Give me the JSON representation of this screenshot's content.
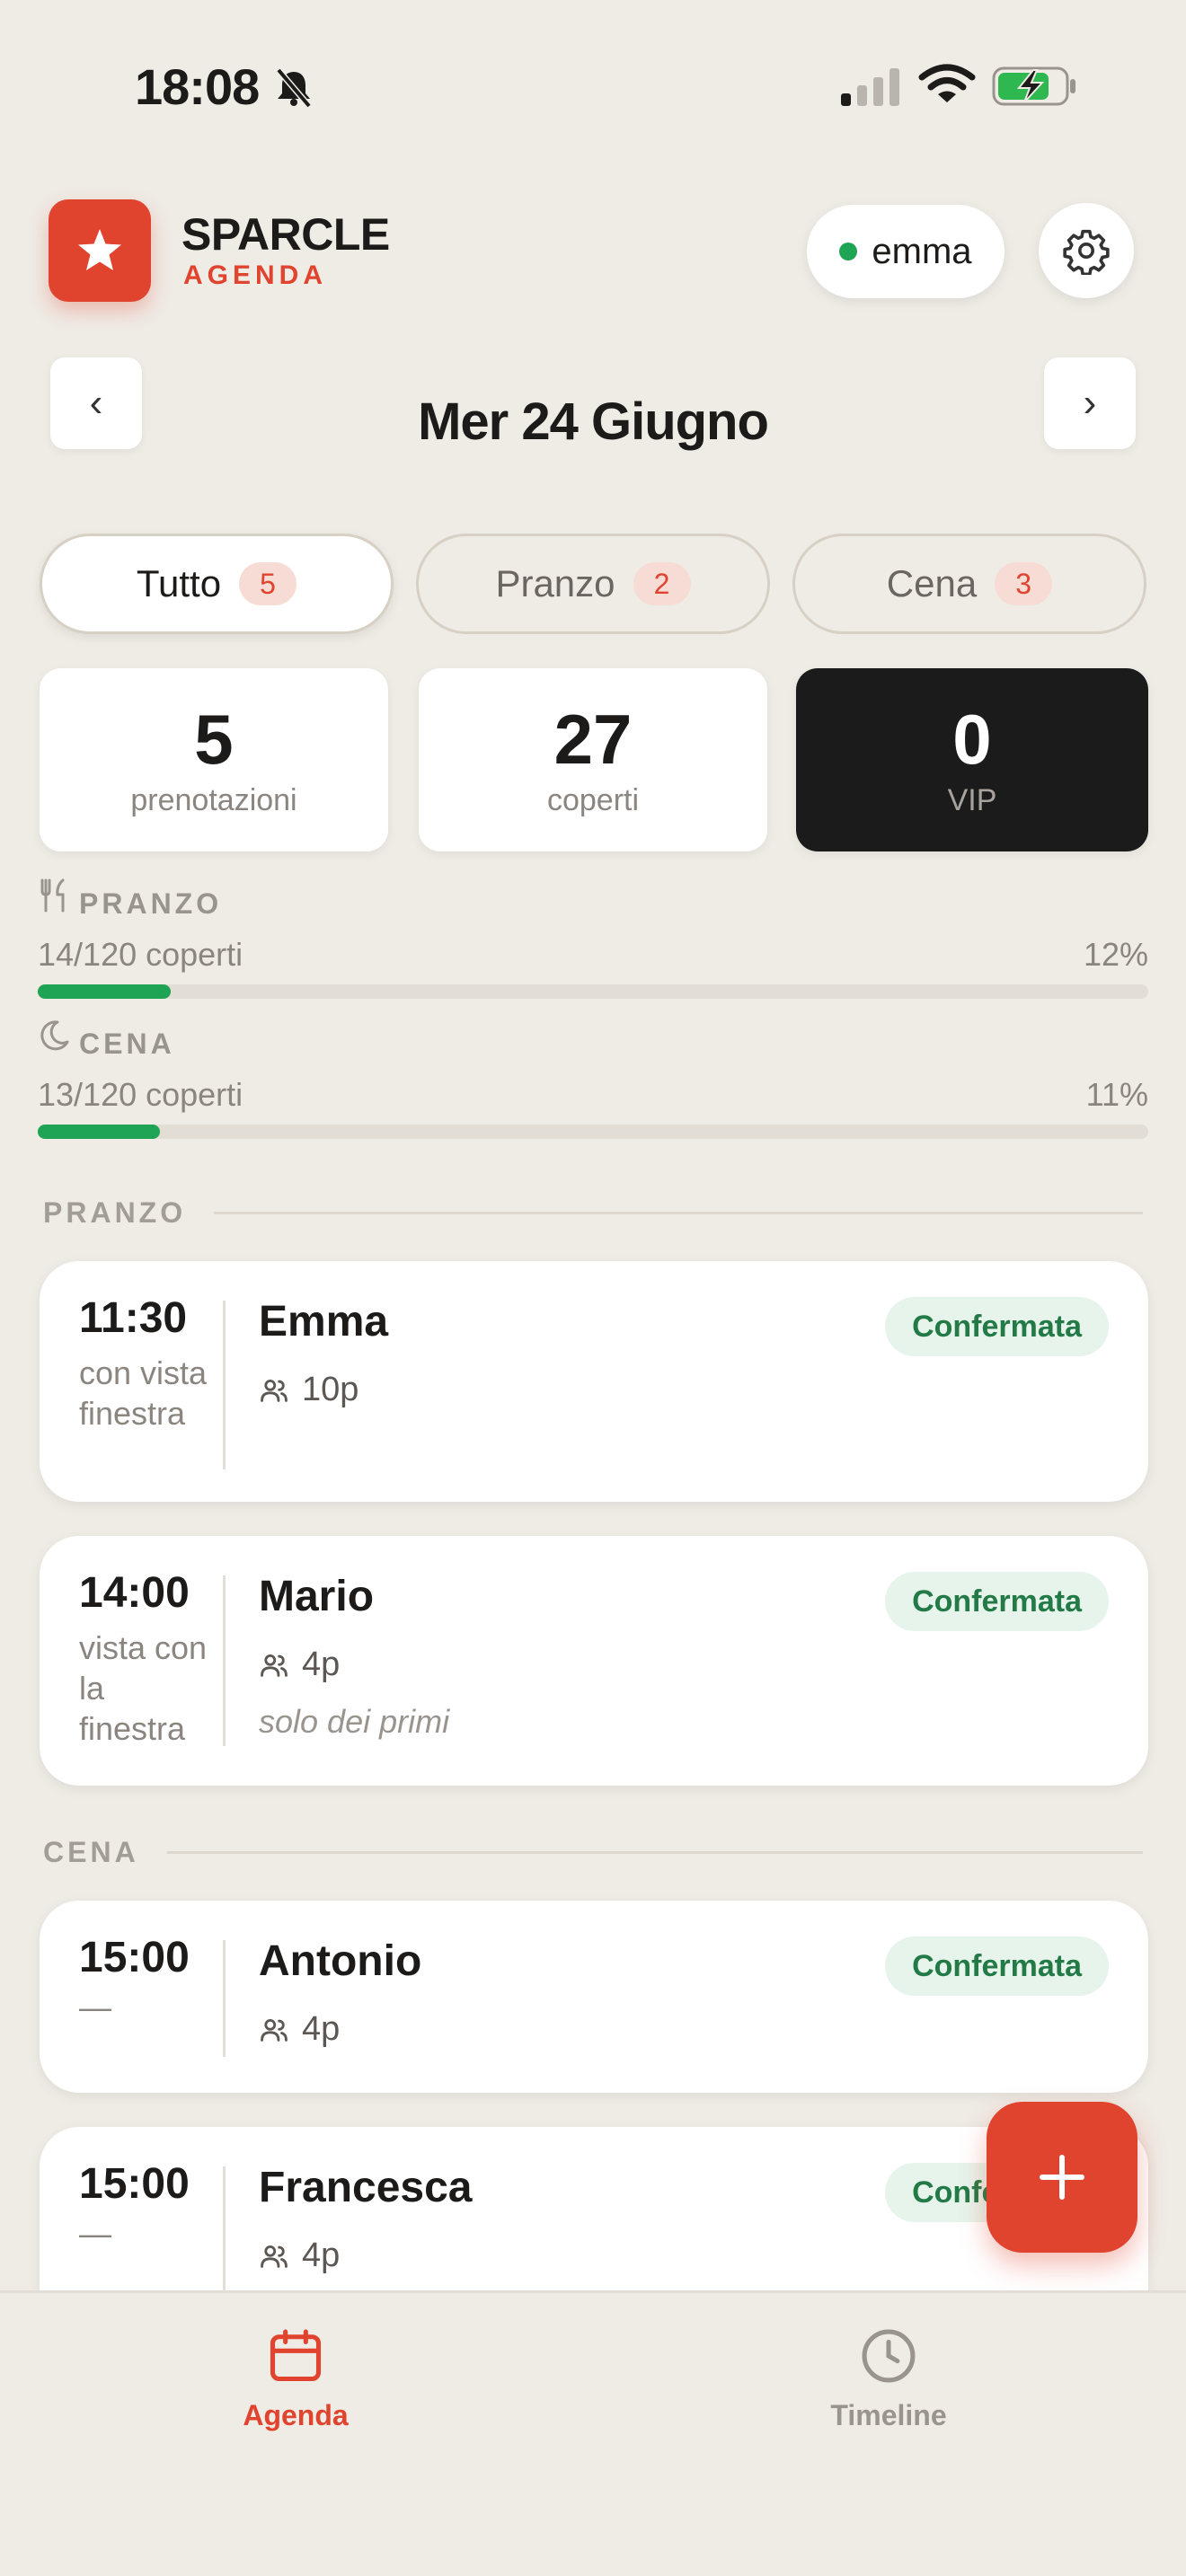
{
  "status_bar": {
    "time": "18:08"
  },
  "header": {
    "brand_name": "SPARCLE",
    "brand_sub": "AGENDA",
    "user": "emma",
    "accent_color": "#e0442f",
    "online_color": "#1fa456"
  },
  "date_nav": {
    "prev": "‹",
    "next": "›",
    "date": "Mer 24 Giugno"
  },
  "filters": [
    {
      "label": "Tutto",
      "count": "5",
      "active": true
    },
    {
      "label": "Pranzo",
      "count": "2",
      "active": false
    },
    {
      "label": "Cena",
      "count": "3",
      "active": false
    }
  ],
  "stats": [
    {
      "value": "5",
      "label": "prenotazioni"
    },
    {
      "value": "27",
      "label": "coperti"
    },
    {
      "value": "0",
      "label": "VIP"
    }
  ],
  "capacity": [
    {
      "title": "PRANZO",
      "text": "14/120 coperti",
      "percent_label": "12%",
      "fill": 0.12,
      "icon": "utensils-icon"
    },
    {
      "title": "CENA",
      "text": "13/120 coperti",
      "percent_label": "11%",
      "fill": 0.11,
      "icon": "moon-icon"
    }
  ],
  "sections": [
    {
      "title": "PRANZO",
      "reservations": [
        {
          "time": "11:30",
          "note": "con vista finestra",
          "name": "Emma",
          "party": "10p",
          "comment": "",
          "status": "Confermata"
        },
        {
          "time": "14:00",
          "note": "vista con la finestra",
          "name": "Mario",
          "party": "4p",
          "comment": "solo dei primi",
          "status": "Confermata"
        }
      ]
    },
    {
      "title": "CENA",
      "reservations": [
        {
          "time": "15:00",
          "note": "—",
          "name": "Antonio",
          "party": "4p",
          "comment": "",
          "status": "Confermata"
        },
        {
          "time": "15:00",
          "note": "—",
          "name": "Francesca",
          "party": "4p",
          "comment": "",
          "status": "Confermata"
        }
      ]
    }
  ],
  "fab": {
    "icon": "plus-icon"
  },
  "bottom_nav": [
    {
      "label": "Agenda",
      "icon": "calendar-icon",
      "active": true
    },
    {
      "label": "Timeline",
      "icon": "clock-icon",
      "active": false
    }
  ]
}
